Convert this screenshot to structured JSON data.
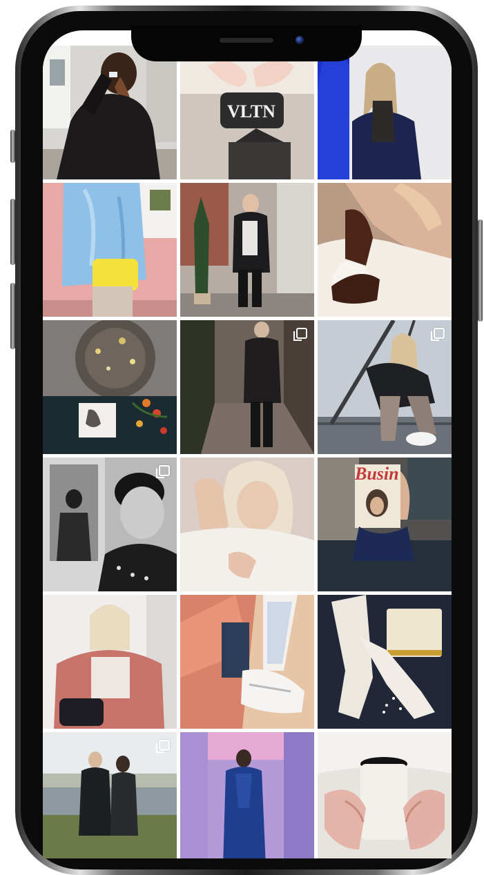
{
  "device": "iphone-x",
  "screen": {
    "grid_title": "",
    "colors": {
      "background": "#ffffff",
      "frame": "#0b0b0b"
    }
  },
  "posts": [
    {
      "name": "post-leather-jacket-ponytail",
      "multi": false
    },
    {
      "name": "post-vltn-clutch",
      "multi": false,
      "overlay_text": "VLTN"
    },
    {
      "name": "post-blue-coat-blonde",
      "multi": false
    },
    {
      "name": "post-blue-fur-yellow-bag",
      "multi": false
    },
    {
      "name": "post-man-black-coat-balcony",
      "multi": false
    },
    {
      "name": "post-brown-gloves-scarf",
      "multi": false
    },
    {
      "name": "post-jewelry-flatlay",
      "multi": false
    },
    {
      "name": "post-man-coat-alley",
      "multi": true
    },
    {
      "name": "post-woman-crouching-pier",
      "multi": true
    },
    {
      "name": "post-bw-woman-mirror",
      "multi": true
    },
    {
      "name": "post-blonde-white-fur",
      "multi": false
    },
    {
      "name": "post-business-magazine",
      "multi": false,
      "overlay_text": "Busin"
    },
    {
      "name": "post-pink-fur-coat",
      "multi": false
    },
    {
      "name": "post-pink-sneakers",
      "multi": false
    },
    {
      "name": "post-white-gloves",
      "multi": false
    },
    {
      "name": "post-couple-lakeside",
      "multi": true
    },
    {
      "name": "post-purple-room-woman",
      "multi": false
    },
    {
      "name": "post-coffee-cup-gloves",
      "multi": false
    }
  ]
}
